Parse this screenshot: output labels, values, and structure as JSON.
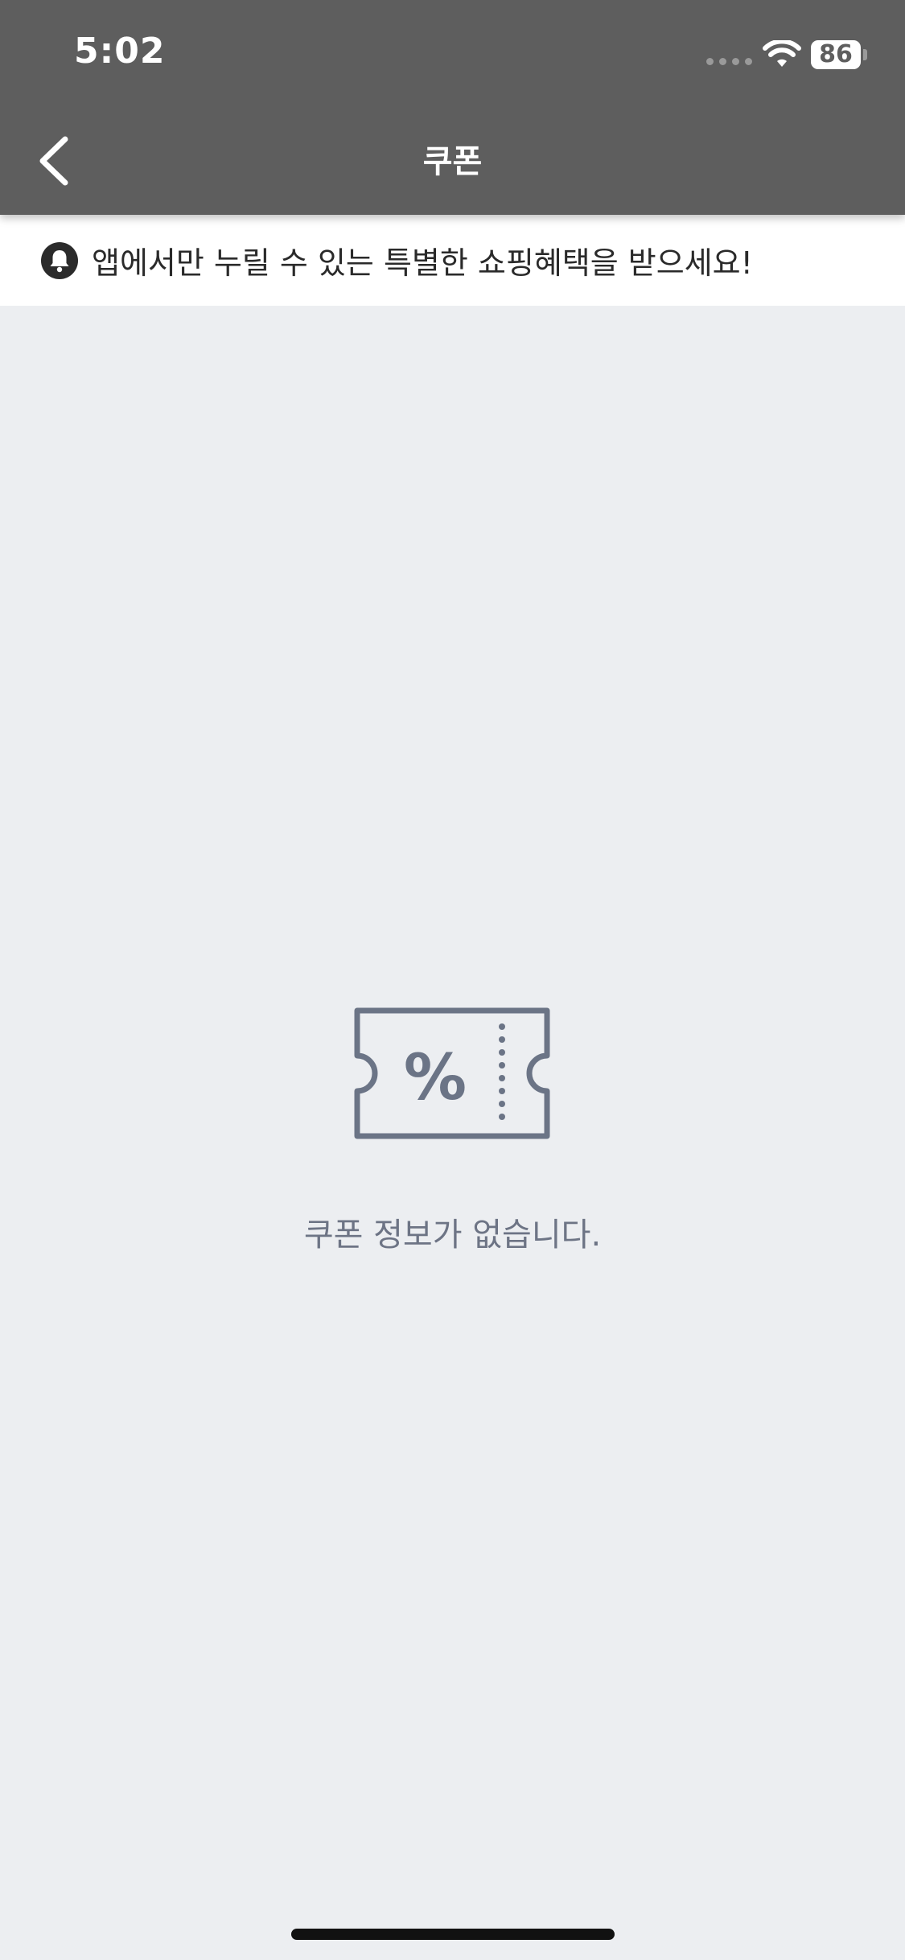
{
  "status_bar": {
    "time": "5:02",
    "battery": "86"
  },
  "header": {
    "title": "쿠폰"
  },
  "notice": {
    "text": "앱에서만 누릴 수 있는 특별한 쇼핑혜택을 받으세요!"
  },
  "empty_state": {
    "icon": "coupon-percent-icon",
    "message": "쿠폰 정보가 없습니다."
  },
  "colors": {
    "header_bg": "#5e5e5e",
    "page_bg": "#eceef1",
    "empty_text": "#6d7485"
  }
}
